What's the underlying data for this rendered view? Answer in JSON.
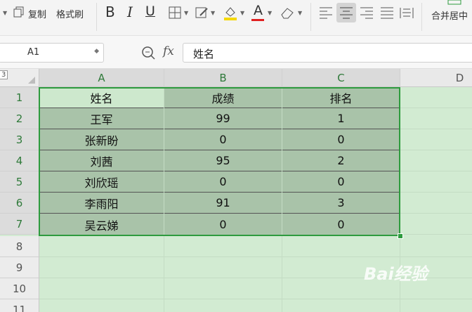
{
  "toolbar": {
    "copy_label": "复制",
    "format_painter_label": "格式刷",
    "bold_label": "B",
    "italic_label": "I",
    "underline_label": "U",
    "font_color_label": "A",
    "merge_center_label": "合并居中"
  },
  "formula_bar": {
    "name_box": "A1",
    "fx_label": "fx",
    "content": "姓名"
  },
  "sheet": {
    "corner_label": "3",
    "columns": [
      "A",
      "B",
      "C",
      "D"
    ],
    "rows": [
      "1",
      "2",
      "3",
      "4",
      "5",
      "6",
      "7",
      "8",
      "9",
      "10",
      "11"
    ],
    "cells": [
      [
        "姓名",
        "成绩",
        "排名"
      ],
      [
        "王军",
        "99",
        "1"
      ],
      [
        "张新盼",
        "0",
        "0"
      ],
      [
        "刘茜",
        "95",
        "2"
      ],
      [
        "刘欣瑶",
        "0",
        "0"
      ],
      [
        "李雨阳",
        "91",
        "3"
      ],
      [
        "吴云娣",
        "0",
        "0"
      ]
    ]
  },
  "watermark": "Bai经验",
  "colors": {
    "selection_border": "#2e9b3e",
    "data_fill": "#a9c3a9",
    "sheet_bg": "#d2ebd2"
  }
}
